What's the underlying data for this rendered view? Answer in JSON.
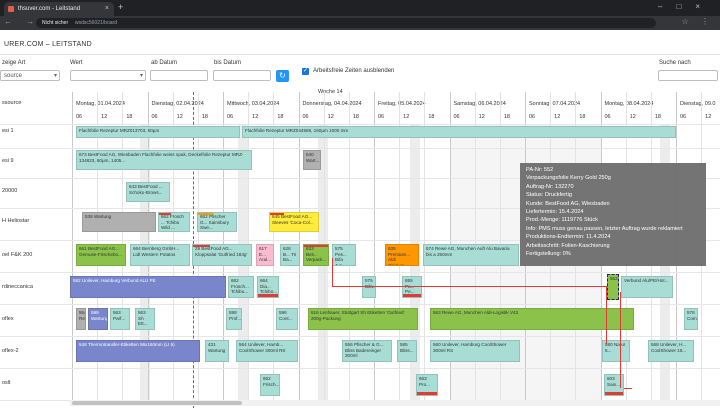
{
  "browser": {
    "tab_title": "thsuver.com - Leitstand",
    "new_tab": "+",
    "window_controls": "–□×",
    "nav": "← → ↻",
    "secure_label": "Nicht sicher",
    "url": "wsdsc56021/board",
    "icons": "☆ ⋮"
  },
  "app": {
    "title": "URER.COM – LEITSTAND"
  },
  "filters": {
    "anzeige_art_label": "zeige Art",
    "anzeige_art_value": "source",
    "wert_label": "Wert",
    "ab_datum_label": "ab Datum",
    "bis_datum_label": "bis Datum",
    "refresh_icon": "↻",
    "checkbox_check": "✓",
    "arbeitsfrei_label": "Arbeitsfreie Zeiten ausblenden",
    "suche_label": "Suche nach"
  },
  "gantt": {
    "resource_header": "ssource",
    "week_label": "Woche 14",
    "days": [
      "Montag, 01.04.2024",
      "Dienstag, 02.04.2024",
      "Mittwoch, 03.04.2024",
      "Donnerstag, 04.04.2024",
      "Freitag, 05.04.2024",
      "Samstag, 06.04.2024",
      "Sonntag, 07.04.2024",
      "Montag, 08.04.2024",
      "Dienstag, 09.0"
    ],
    "hours": [
      "06",
      "12",
      "18",
      "06",
      "12",
      "18",
      "06",
      "12",
      "18",
      "06",
      "12",
      "18",
      "06",
      "12",
      "18",
      "06",
      "12",
      "18",
      "06",
      "12",
      "18",
      "06",
      "12",
      "18",
      "06",
      "12"
    ],
    "resources": [
      "esi 1",
      "esi 9",
      "20000",
      "H Heliostar",
      "oel F&K 200",
      "rdineccanica",
      "oflex",
      "oflex-2",
      "oslt"
    ],
    "bars": [
      {
        "text": "Flachfolie Rezeptur MRZ013703, 60µm"
      },
      {
        "text": "Flachfolie Rezeptur MRZ044586, 160µm 1000 mm"
      },
      {
        "text": "673 BestFood AG, Wiesbaden Flachfolie weiss opak, Deckelfolie Rezeptur MRZ-134823, 60µm, 1405..."
      },
      {
        "text": "540 Wart..."
      },
      {
        "text": "643 BestFood ... Schoko-Brows..."
      },
      {
        "text": "538 Wartung"
      },
      {
        "text": "662 Frosch ... Tchibo Wild ..."
      },
      {
        "text": "662 Pfischer G... Sainsbury Swe..."
      },
      {
        "text": "645 BestFood AG... Sleeves 'Coca-Col..."
      },
      {
        "text": "661 BestFood AG... Gemuse-Frischebo..."
      },
      {
        "text": "664 Bernberg GmbH... Lidl Western Potatos"
      },
      {
        "text": "29 BestFood AG... Kloppsalat 'Gutfried 183g'"
      },
      {
        "text": "617 E... Aral..."
      },
      {
        "text": "628 B... Tri Ba..."
      },
      {
        "text": "633 Bes... Verpack..."
      },
      {
        "text": "575 Pes... Bifa Jun..."
      },
      {
        "text": "635 Premium... Aldi Chicken..."
      },
      {
        "text": "574 Rewe AG, Munchen Auft Alu Bavaria bis a 250mm"
      },
      {
        "text": "592 Unilever, Hamburg Verbund ALU PE"
      },
      {
        "text": "662 Frosch... Tchibo..."
      },
      {
        "text": "664 Dia... Tchibo..."
      },
      {
        "text": "575 Bifa..."
      },
      {
        "text": "655 Pa... Pe..."
      },
      {
        "text": "552"
      },
      {
        "text": "Verbund Alu/PE/Hot..."
      },
      {
        "text": "554 Ret..."
      },
      {
        "text": "599 Wartung"
      },
      {
        "text": "563 Parf..."
      },
      {
        "text": "563 Sh Ett..."
      },
      {
        "text": "598 Prof..."
      },
      {
        "text": "596 Cont..."
      },
      {
        "text": "616 Lenhauer, Stuttgart Sh Etiketten 'Gutfried' 200g-Packung"
      },
      {
        "text": "563 Rewe AG, Munchen Aldi-Logistik V43"
      },
      {
        "text": "576 Com..."
      },
      {
        "text": "548 Thermotransfer-Etiketten 56x160mm (LI 5)"
      },
      {
        "text": "431 Wartung"
      },
      {
        "text": "564 Unilever, Hamb... CoolShower 300ml RS"
      },
      {
        "text": "556 Pfischer & G... Bliss Badereinger 300ml"
      },
      {
        "text": "585 Bliss..."
      },
      {
        "text": "560 Unilever, Hamburg CoolShower 300ml RS"
      },
      {
        "text": "580 Natur 5..."
      },
      {
        "text": "568 Unilever, H... CoolShower 18..."
      },
      {
        "text": "662 Frisch..."
      },
      {
        "text": "663 Pro..."
      },
      {
        "text": "603 Sain..."
      }
    ]
  },
  "tooltip": {
    "lines": [
      "PA-Nr: 552",
      "Verpackungsfolie Kerry Gold 250g",
      "Auftrag-Nr: 132270",
      "Status: Druckfertig",
      "Kunde: BestFood AG, Wiesbaden",
      "Liefertermin: 15.4.2024",
      "Prod.-Menge: 1119776 Stück",
      "Info: PMS muss genau passen, letzter Auftrag wurde reklamiert",
      "Produktions-Endtermin: 11.4.2024",
      "Arbeitsschritt: Folien-Kaschierung",
      "Fertigstellung: 0%"
    ]
  },
  "colors": {
    "teal": "#a8ddd6",
    "blue": "#7986cb",
    "green": "#8bc34a",
    "red": "#e53935",
    "accent": "#2196f3"
  }
}
